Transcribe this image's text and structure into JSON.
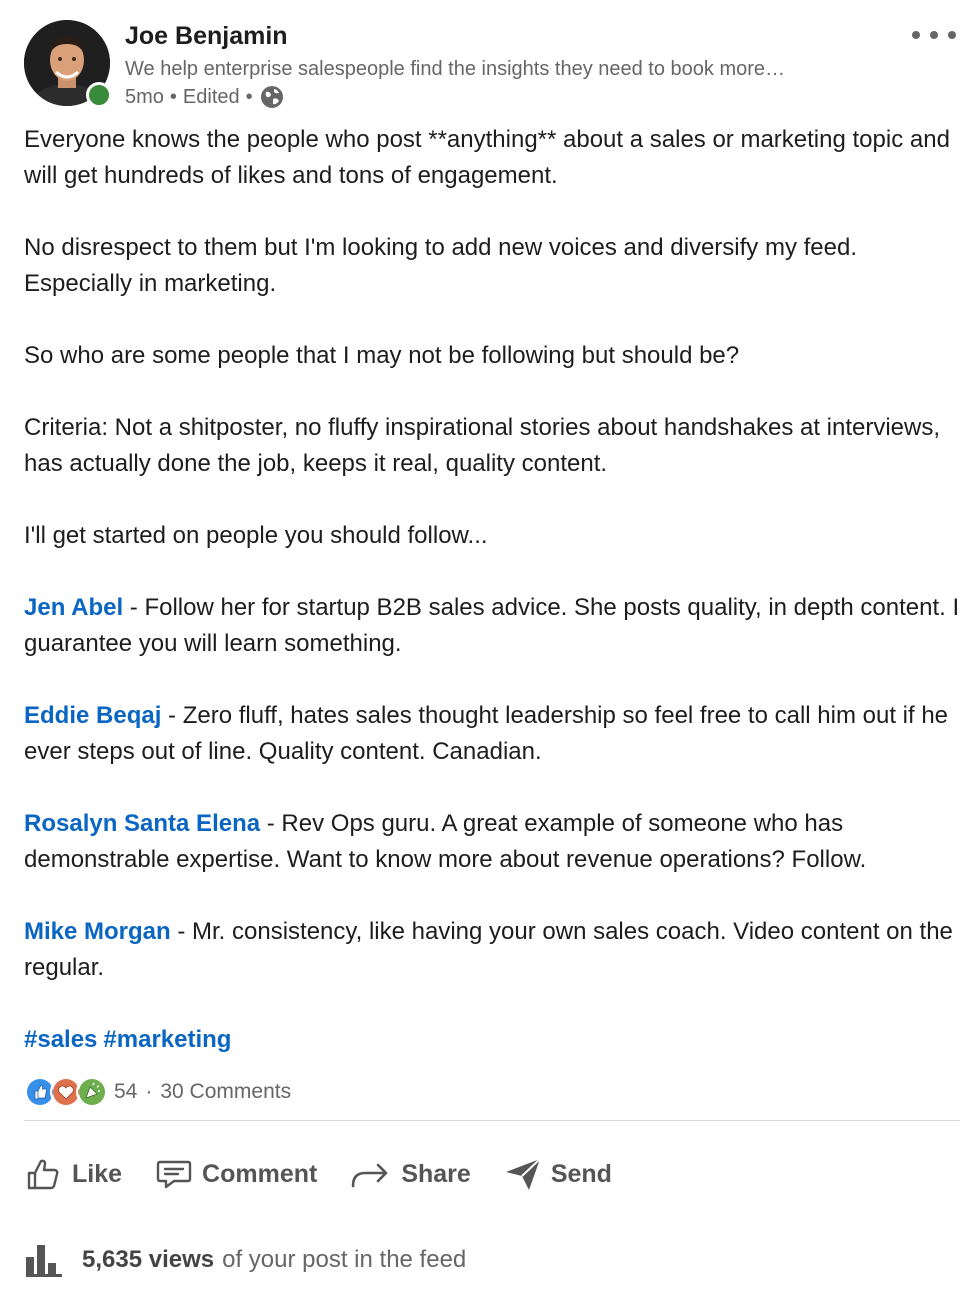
{
  "author": {
    "name": "Joe Benjamin",
    "headline": "We help enterprise salespeople find the insights they need to book more…",
    "time": "5mo",
    "edited": "Edited",
    "visibility_icon": "globe-icon",
    "online_status_color": "#3a8b3c"
  },
  "menu": {
    "icon": "ellipsis-icon"
  },
  "post": {
    "paragraphs": [
      "Everyone knows the people who post **anything** about a sales or marketing topic and will get hundreds of likes and tons of engagement.",
      "No disrespect to them but I'm looking to add new voices and diversify my feed. Especially in marketing.",
      "So who are some people that I may not be following but should be?",
      "Criteria: Not a shitposter, no fluffy inspirational stories about handshakes at interviews, has actually done the job, keeps it real, quality content.",
      "I'll get started on people you should follow..."
    ],
    "recommendations": [
      {
        "name": "Jen Abel",
        "text": " - Follow her for startup B2B sales advice. She posts quality, in depth content. I guarantee you will learn something."
      },
      {
        "name": "Eddie Beqaj",
        "text": " - Zero fluff, hates sales thought leadership so feel free to call him out if he ever steps out of line. Quality content. Canadian."
      },
      {
        "name": "Rosalyn Santa Elena",
        "text": " - Rev Ops guru. A great example of someone who has demonstrable expertise. Want to know more about revenue operations? Follow."
      },
      {
        "name": "Mike Morgan",
        "text": " - Mr. consistency, like having your own sales coach. Video content on the regular."
      }
    ],
    "hashtags": [
      "#sales",
      "#marketing"
    ]
  },
  "social": {
    "reaction_icons": [
      "like-reaction-icon",
      "love-reaction-icon",
      "celebrate-reaction-icon"
    ],
    "reaction_count": "54",
    "separator": "·",
    "comments": "30 Comments"
  },
  "actions": {
    "like": "Like",
    "comment": "Comment",
    "share": "Share",
    "send": "Send"
  },
  "analytics": {
    "views": "5,635 views",
    "suffix": "of your post in the feed"
  },
  "colors": {
    "link": "#0a66c2",
    "text": "#1d1d1d",
    "secondary": "#666666"
  }
}
